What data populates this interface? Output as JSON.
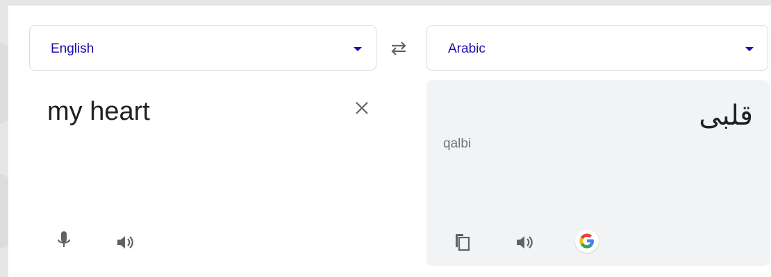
{
  "source_language": {
    "label": "English"
  },
  "target_language": {
    "label": "Arabic"
  },
  "source": {
    "text": "my heart"
  },
  "target": {
    "text": "قلبى",
    "transliteration": "qalbi"
  },
  "icons": {
    "swap": "swap-languages-icon",
    "clear": "close-icon",
    "mic": "microphone-icon",
    "speaker": "speaker-icon",
    "copy": "copy-icon",
    "google": "google-g-logo"
  },
  "colors": {
    "language_label": "#1a0dab",
    "icon_gray": "#5f6368",
    "result_panel": "#f1f3f4",
    "google_blue": "#4285F4",
    "google_red": "#EA4335",
    "google_yellow": "#FBBC05",
    "google_green": "#34A853"
  }
}
